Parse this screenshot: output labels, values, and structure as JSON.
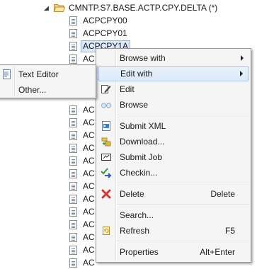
{
  "tree": {
    "parent_label": "CMNTP.S7.BASE.ACTP.CPY.DELTA (*)",
    "children": [
      "ACPCPY00",
      "ACPCPY01",
      "ACPCPY1A",
      "AC",
      "",
      "",
      "",
      "AC",
      "AC",
      "AC",
      "AC",
      "AC",
      "AC",
      "AC",
      "AC",
      "AC",
      "AC",
      "AC",
      "AC",
      "AC",
      "AC"
    ]
  },
  "context_menu": {
    "items": [
      {
        "label": "Browse with",
        "icon": "none",
        "submenu": true
      },
      {
        "label": "Edit with",
        "icon": "none",
        "submenu": true
      },
      {
        "label": "Edit",
        "icon": "edit-pencil-icon"
      },
      {
        "label": "Browse",
        "icon": "browse-glasses-icon"
      },
      {
        "label": "Submit XML",
        "icon": "submit-xml-icon"
      },
      {
        "label": "Download...",
        "icon": "download-icon"
      },
      {
        "label": "Submit Job",
        "icon": "submit-job-icon"
      },
      {
        "label": "Checkin...",
        "icon": "checkin-icon"
      },
      {
        "label": "Delete",
        "icon": "delete-x-icon",
        "shortcut": "Delete"
      },
      {
        "label": "Search...",
        "icon": "none"
      },
      {
        "label": "Refresh",
        "icon": "refresh-icon",
        "shortcut": "F5"
      },
      {
        "label": "Properties",
        "icon": "none",
        "shortcut": "Alt+Enter"
      }
    ]
  },
  "submenu": {
    "items": [
      {
        "label": "Text Editor",
        "icon": "text-editor-icon"
      },
      {
        "label": "Other...",
        "icon": "none"
      }
    ]
  },
  "colors": {
    "menu_bg": "#f5f5f5",
    "hover_bg": "#dbe9f9",
    "selection_bg": "#d9e8fb",
    "delete_red": "#d9342b"
  }
}
